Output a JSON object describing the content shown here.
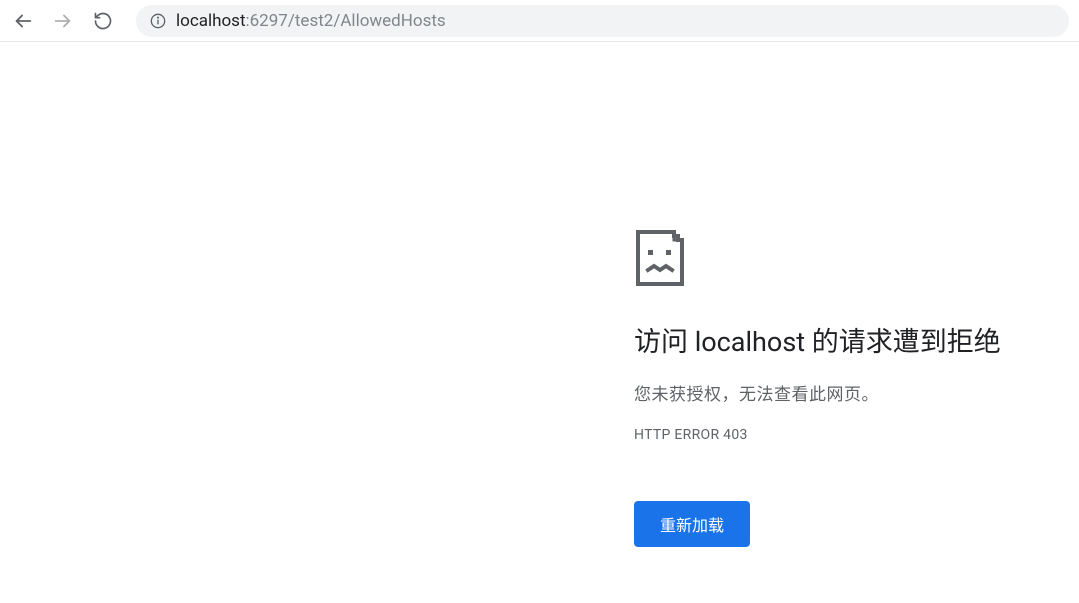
{
  "toolbar": {
    "url_host": "localhost",
    "url_rest": ":6297/test2/AllowedHosts"
  },
  "error": {
    "title_prefix": "访问 ",
    "title_host": "localhost",
    "title_suffix": " 的请求遭到拒绝",
    "subtitle": "您未获授权，无法查看此网页。",
    "code": "HTTP ERROR 403",
    "reload_label": "重新加载"
  }
}
